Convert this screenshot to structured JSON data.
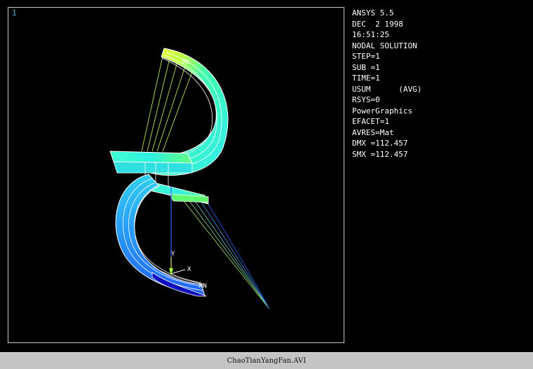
{
  "viewport": {
    "window_number": "1",
    "triad_labels": {
      "y": "Y",
      "x": "X"
    },
    "max_label": "MX",
    "min_label": "MN"
  },
  "legend": {
    "lines": [
      "ANSYS 5.5",
      "DEC  2 1998",
      "16:51:25",
      "NODAL SOLUTION",
      "STEP=1",
      "SUB =1",
      "TIME=1",
      "USUM      (AVG)",
      "RSYS=0",
      "PowerGraphics",
      "EFACET=1",
      "AVRES=Mat",
      "DMX =112.457",
      "SMX =112.457"
    ]
  },
  "statusbar": {
    "filename": "ChaoTianYangFan.AVI"
  },
  "colors": {
    "background": "#000000",
    "frame": "#c8c8c8",
    "contour_high": "#ffff40",
    "contour_mid": "#40ffb0",
    "contour_cyan": "#30e8f0",
    "contour_blue": "#2080ff",
    "contour_low": "#1010c0",
    "cable": "#c8ff60"
  }
}
